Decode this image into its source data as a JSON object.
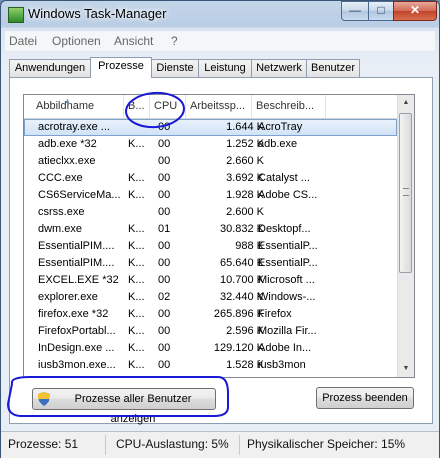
{
  "window": {
    "title": "Windows Task-Manager"
  },
  "menu": [
    "Datei",
    "Optionen",
    "Ansicht",
    "?"
  ],
  "tabs": [
    "Anwendungen",
    "Prozesse",
    "Dienste",
    "Leistung",
    "Netzwerk",
    "Benutzer"
  ],
  "active_tab": "Prozesse",
  "columns": {
    "name": "Abbildname",
    "user": "B...",
    "cpu": "CPU",
    "mem": "Arbeitssp...",
    "desc": "Beschreib..."
  },
  "processes": [
    {
      "name": "acrotray.exe ...",
      "user": "",
      "cpu": "00",
      "mem": "1.644 K",
      "desc": "AcroTray",
      "selected": true
    },
    {
      "name": "adb.exe *32",
      "user": "K...",
      "cpu": "00",
      "mem": "1.252 K",
      "desc": "adb.exe"
    },
    {
      "name": "atieclxx.exe",
      "user": "",
      "cpu": "00",
      "mem": "2.660 K",
      "desc": ""
    },
    {
      "name": "CCC.exe",
      "user": "K...",
      "cpu": "00",
      "mem": "3.692 K",
      "desc": "Catalyst ..."
    },
    {
      "name": "CS6ServiceMa...",
      "user": "K...",
      "cpu": "00",
      "mem": "1.928 K",
      "desc": "Adobe CS..."
    },
    {
      "name": "csrss.exe",
      "user": "",
      "cpu": "00",
      "mem": "2.600 K",
      "desc": ""
    },
    {
      "name": "dwm.exe",
      "user": "K...",
      "cpu": "01",
      "mem": "30.832 K",
      "desc": "Desktopf..."
    },
    {
      "name": "EssentialPIM....",
      "user": "K...",
      "cpu": "00",
      "mem": "988 K",
      "desc": "EssentialP..."
    },
    {
      "name": "EssentialPIM....",
      "user": "K...",
      "cpu": "00",
      "mem": "65.640 K",
      "desc": "EssentialP..."
    },
    {
      "name": "EXCEL.EXE *32",
      "user": "K...",
      "cpu": "00",
      "mem": "10.700 K",
      "desc": "Microsoft ..."
    },
    {
      "name": "explorer.exe",
      "user": "K...",
      "cpu": "02",
      "mem": "32.440 K",
      "desc": "Windows-..."
    },
    {
      "name": "firefox.exe *32",
      "user": "K...",
      "cpu": "00",
      "mem": "265.896 K",
      "desc": "Firefox"
    },
    {
      "name": "FirefoxPortabl...",
      "user": "K...",
      "cpu": "00",
      "mem": "2.596 K",
      "desc": "Mozilla Fir..."
    },
    {
      "name": "InDesign.exe ...",
      "user": "K...",
      "cpu": "00",
      "mem": "129.120 K",
      "desc": "Adobe In..."
    },
    {
      "name": "iusb3mon.exe...",
      "user": "K...",
      "cpu": "00",
      "mem": "1.528 K",
      "desc": "iusb3mon"
    }
  ],
  "buttons": {
    "show_all": "Prozesse aller Benutzer anzeigen",
    "end_process": "Prozess beenden"
  },
  "status": {
    "processes": "Prozesse: 51",
    "cpu": "CPU-Auslastung: 5%",
    "memory": "Physikalischer Speicher: 15%"
  },
  "colors": {
    "annotation": "#1a1ad6",
    "selection": "#cfe2f7"
  }
}
